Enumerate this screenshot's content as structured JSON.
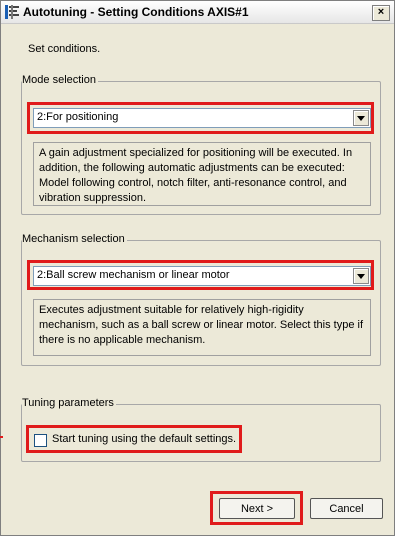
{
  "window": {
    "title": "Autotuning - Setting Conditions AXIS#1",
    "close_label": "×"
  },
  "instruction": "Set conditions.",
  "mode_selection": {
    "label": "Mode selection",
    "selected": "2:For positioning",
    "description": "A gain adjustment specialized for positioning will be executed. In addition, the following automatic adjustments can be executed: Model following control, notch filter, anti-resonance control, and vibration suppression."
  },
  "mechanism_selection": {
    "label": "Mechanism selection",
    "selected": "2:Ball screw mechanism or linear motor",
    "description": "Executes adjustment suitable for relatively high-rigidity mechanism, such as a ball screw or linear motor. Select this type if there is no applicable mechanism."
  },
  "tuning_parameters": {
    "label": "Tuning parameters",
    "checkbox_label": "Start tuning using the default settings.",
    "checked": false
  },
  "buttons": {
    "next": "Next >",
    "cancel": "Cancel"
  },
  "colors": {
    "highlight": "#e01b1b",
    "dialog_bg": "#ece9d8"
  }
}
